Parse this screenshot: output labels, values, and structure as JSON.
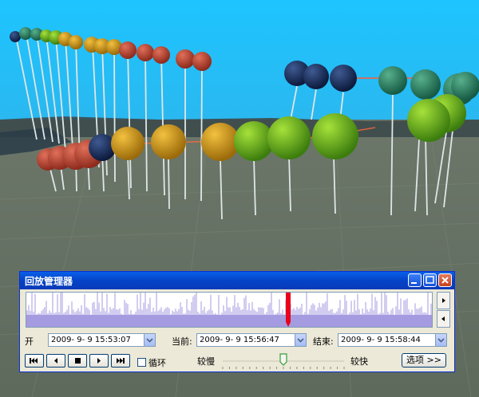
{
  "window": {
    "title": "回放管理器"
  },
  "range": {
    "start_label": "开",
    "start_value": "2009- 9- 9 15:53:07",
    "current_label": "当前:",
    "current_value": "2009- 9- 9 15:56:47",
    "end_label": "结束:",
    "end_value": "2009- 9- 9 15:58:44"
  },
  "playback": {
    "loop_label": "循环",
    "loop_checked": false,
    "slow_label": "较慢",
    "fast_label": "较快",
    "speed_fraction": 0.5,
    "options_label": "选项 >>"
  },
  "timeline": {
    "cursor_fraction": 0.645
  },
  "colors": {
    "sky": "#1fc3ff",
    "title_bar": "#0a5fe8",
    "timeline_fill": "#a59be0",
    "cursor": "#e8001c"
  },
  "icons": [
    "skip-to-start-icon",
    "step-back-icon",
    "stop-icon",
    "play-icon",
    "skip-to-end-icon",
    "next-arrow-icon",
    "prev-arrow-icon",
    "minimize-icon",
    "maximize-icon",
    "close-icon",
    "slider-thumb-icon"
  ]
}
